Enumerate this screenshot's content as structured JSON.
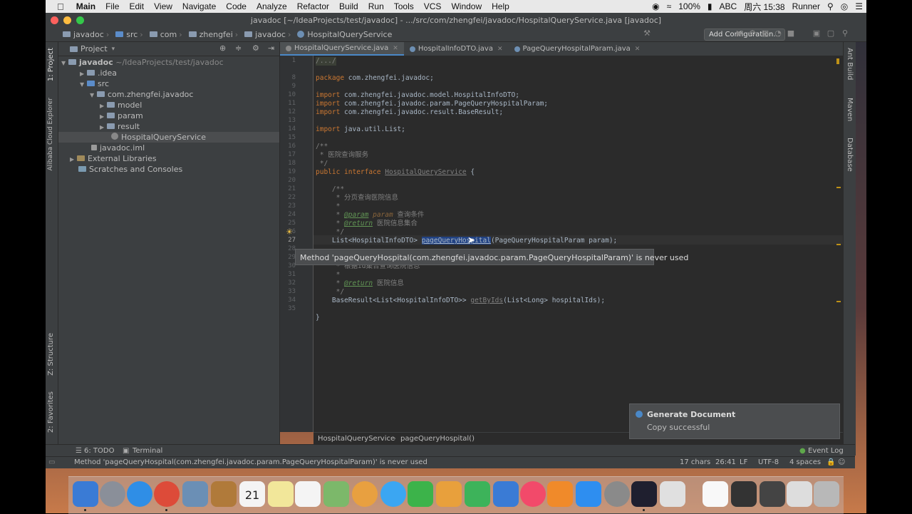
{
  "menubar": {
    "app": "Main",
    "items": [
      "File",
      "Edit",
      "View",
      "Navigate",
      "Code",
      "Analyze",
      "Refactor",
      "Build",
      "Run",
      "Tools",
      "VCS",
      "Window",
      "Help"
    ],
    "battery": "100%",
    "input": "ABC",
    "clock": "周六 15:38",
    "user": "Runner"
  },
  "window": {
    "title": "javadoc [~/IdeaProjects/test/javadoc] - .../src/com/zhengfei/javadoc/HospitalQueryService.java [javadoc]"
  },
  "navbar": {
    "crumbs": [
      "javadoc",
      "src",
      "com",
      "zhengfei",
      "javadoc",
      "HospitalQueryService"
    ],
    "add_config": "Add Configuration..."
  },
  "left_strip": {
    "project_tab": "1: Project",
    "cloud_tab": "Alibaba Cloud Explorer",
    "structure_tab": "Z: Structure",
    "favorites_tab": "2: Favorites"
  },
  "project": {
    "header": "Project",
    "root_name": "javadoc",
    "root_path": "~/IdeaProjects/test/javadoc",
    "idea": ".idea",
    "src": "src",
    "package": "com.zhengfei.javadoc",
    "model": "model",
    "param": "param",
    "result": "result",
    "service": "HospitalQueryService",
    "iml": "javadoc.iml",
    "external": "External Libraries",
    "scratches": "Scratches and Consoles"
  },
  "tabs": [
    "HospitalQueryService.java",
    "HospitalInfoDTO.java",
    "PageQueryHospitalParam.java"
  ],
  "line_numbers": [
    "1",
    "8",
    "9",
    "10",
    "11",
    "12",
    "13",
    "14",
    "15",
    "16",
    "17",
    "18",
    "19",
    "20",
    "21",
    "22",
    "23",
    "24",
    "25",
    "26",
    "27",
    "28",
    "29",
    "30",
    "31",
    "32",
    "33",
    "34",
    "35"
  ],
  "code": {
    "l1": "/.../",
    "l8_kw": "package",
    "l8": " com.zhengfei.javadoc;",
    "imp": "import",
    "l10": " com.zhengfei.javadoc.model.HospitalInfoDTO;",
    "l11": " com.zhengfei.javadoc.param.PageQueryHospitalParam;",
    "l12": " com.zhengfei.javadoc.result.BaseResult;",
    "l14": " java.util.List;",
    "l16": "/**",
    "l17": " * 医院查询服务",
    "l18": " */",
    "l19_kw": "public interface",
    "l19_name": "HospitalQueryService",
    "l19_rest": " {",
    "l21": "    /**",
    "l22": "     * 分页查询医院信息",
    "l23": "     *",
    "l24_a": "     * ",
    "l24_tag": "@param",
    "l24_par": " param",
    "l24_b": " 查询条件",
    "l25_a": "     * ",
    "l25_tag": "@return",
    "l25_b": " 医院信息集合",
    "l26": "     */",
    "l27_a": "    List<HospitalInfoDTO> ",
    "l27_m": "pageQueryHospital",
    "l27_b": "(PageQueryHospitalParam param);",
    "l30": "     * 根据id集合查询医院信息",
    "l31": "     *",
    "l32_a": "     * ",
    "l32_tag": "@return",
    "l32_b": " 医院信息",
    "l33": "     */",
    "l34_a": "    BaseResult<List<HospitalInfoDTO>> ",
    "l34_m": "getByIds",
    "l34_b": "(List<Long> hospitalIds);",
    "l36": "}"
  },
  "tooltip": "Method 'pageQueryHospital(com.zhengfei.javadoc.param.PageQueryHospitalParam)' is never used",
  "editor_breadcrumb": [
    "HospitalQueryService",
    "pageQueryHospital()"
  ],
  "right_strip": [
    "Ant Build",
    "Maven",
    "Database"
  ],
  "notification": {
    "title": "Generate Document",
    "message": "Copy successful"
  },
  "bottom_tools": {
    "todo": "6: TODO",
    "terminal": "Terminal",
    "event_log": "Event Log"
  },
  "status": {
    "message": "Method 'pageQueryHospital(com.zhengfei.javadoc.param.PageQueryHospitalParam)' is never used",
    "chars": "17 chars",
    "position": "26:41",
    "line_sep": "LF",
    "encoding": "UTF-8",
    "indent": "4 spaces"
  },
  "dock_icons": [
    "finder-icon",
    "launchpad-icon",
    "safari-icon",
    "chrome-icon",
    "preview-icon",
    "contacts-icon",
    "calendar-icon",
    "notes-icon",
    "reminders-icon",
    "maps-icon",
    "photos-icon",
    "messages-icon",
    "facetime-icon",
    "pages-icon",
    "numbers-icon",
    "keynote-icon",
    "music-icon",
    "books-icon",
    "appstore-icon",
    "preferences-icon",
    "intellij-icon",
    "java-icon",
    "document-icon",
    "script-icon",
    "screen-icon",
    "finder2-icon",
    "trash-icon"
  ],
  "calendar_day": "21",
  "colors": {
    "accent": "#4a88c7",
    "keyword": "#cc7832",
    "comment": "#808080",
    "javadoc_tag": "#629755"
  }
}
